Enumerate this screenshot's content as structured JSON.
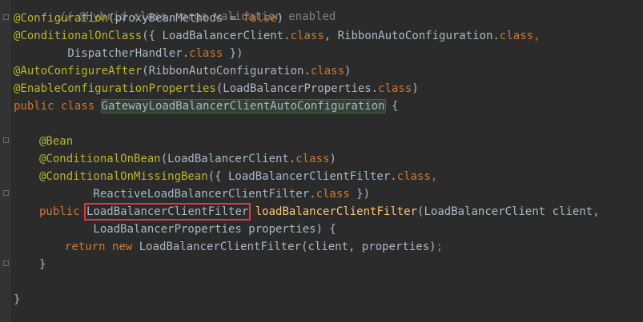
{
  "code": {
    "line0_comment": "// @Hybrid class, orgs validation enabled",
    "line1_anno": "@Configuration",
    "line1_rest": "(proxyBeanMethods = ",
    "line1_kw": "false",
    "line1_end": ")",
    "line2_anno": "@ConditionalOnClass",
    "line2_a": "({ LoadBalancerClient.",
    "line2_kw1": "class",
    "line2_b": ", RibbonAutoConfiguration.",
    "line2_kw2": "class",
    "line2_c": ",",
    "line3_a": "        DispatcherHandler.",
    "line3_kw": "class",
    "line3_b": " })",
    "line4_anno": "@AutoConfigureAfter",
    "line4_a": "(RibbonAutoConfiguration.",
    "line4_kw": "class",
    "line4_b": ")",
    "line5_anno": "@EnableConfigurationProperties",
    "line5_a": "(LoadBalancerProperties.",
    "line5_kw": "class",
    "line5_b": ")",
    "line6_kw": "public class ",
    "line6_class": "GatewayLoadBalancerClientAutoConfiguration",
    "line6_b": " {",
    "line8_anno": "@Bean",
    "line9_anno": "@ConditionalOnBean",
    "line9_a": "(LoadBalancerClient.",
    "line9_kw": "class",
    "line9_b": ")",
    "line10_anno": "@ConditionalOnMissingBean",
    "line10_a": "({ LoadBalancerClientFilter.",
    "line10_kw": "class",
    "line10_b": ",",
    "line11_a": "        ReactiveLoadBalancerClientFilter.",
    "line11_kw": "class",
    "line11_b": " })",
    "line12_kw": "public ",
    "line12_type": "LoadBalancerClientFilter",
    "line12_fn": "loadBalancerClientFilter",
    "line12_a": "(LoadBalancerClient client,",
    "line13_a": "        LoadBalancerProperties properties) {",
    "line14_kw1": "return ",
    "line14_kw2": "new ",
    "line14_a": "LoadBalancerClientFilter(client, properties)",
    "line14_b": ";",
    "line15_a": "}",
    "line17_a": "}"
  }
}
